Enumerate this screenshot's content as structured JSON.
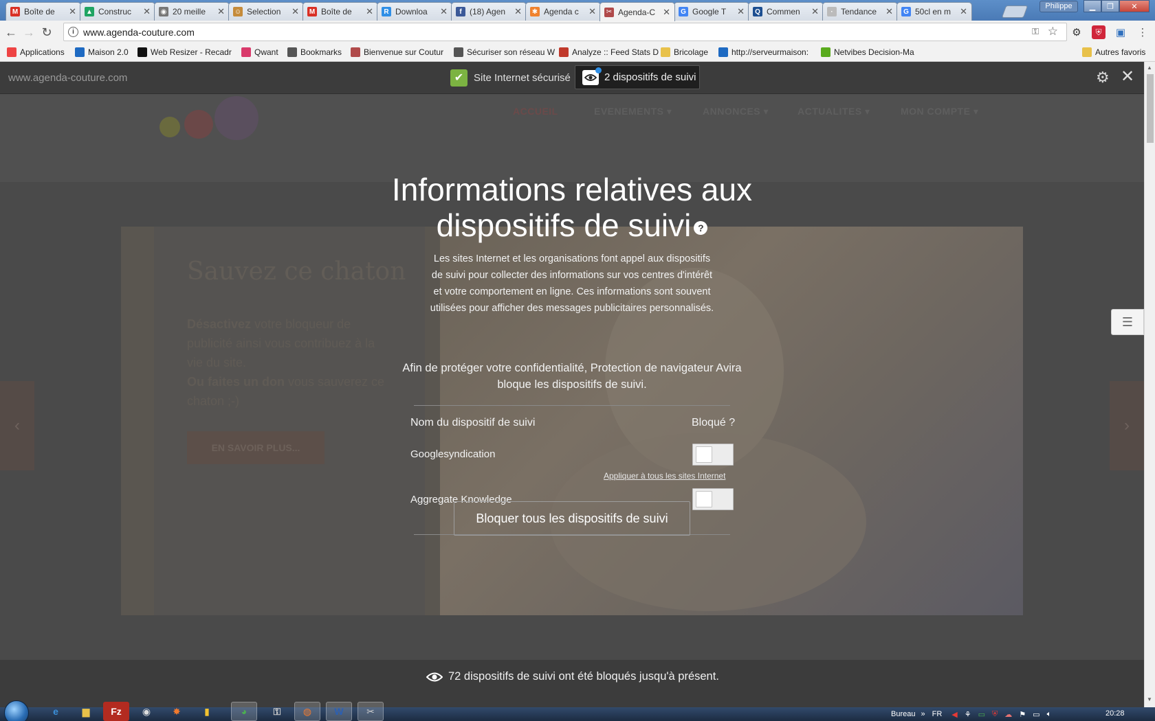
{
  "browser": {
    "tabs": [
      {
        "label": "Boîte de",
        "icon": "gmail-icon",
        "color": "#d93025",
        "glyph": "M"
      },
      {
        "label": "Construc",
        "icon": "drive-icon",
        "color": "#1fa463",
        "glyph": "▲"
      },
      {
        "label": "20 meille",
        "icon": "site-icon",
        "color": "#777777",
        "glyph": "◉"
      },
      {
        "label": "Selection",
        "icon": "site-icon",
        "color": "#c58b3a",
        "glyph": "☺"
      },
      {
        "label": "Boîte de",
        "icon": "gmail-icon",
        "color": "#d93025",
        "glyph": "M"
      },
      {
        "label": "Downloa",
        "icon": "site-icon",
        "color": "#2f8fe6",
        "glyph": "R"
      },
      {
        "label": "(18) Agen",
        "icon": "facebook-icon",
        "color": "#3b5998",
        "glyph": "f"
      },
      {
        "label": "Agenda c",
        "icon": "joomla-icon",
        "color": "#f0822e",
        "glyph": "✱"
      },
      {
        "label": "Agenda-C",
        "icon": "scissors-icon",
        "color": "#b04a4a",
        "glyph": "✂",
        "active": true
      },
      {
        "label": "Google T",
        "icon": "google-icon",
        "color": "#4285f4",
        "glyph": "G"
      },
      {
        "label": "Commen",
        "icon": "qwant-icon",
        "color": "#1d4f91",
        "glyph": "Q"
      },
      {
        "label": "Tendance",
        "icon": "site-icon",
        "color": "#bbbbbb",
        "glyph": "·"
      },
      {
        "label": "50cl en m",
        "icon": "google-icon",
        "color": "#4285f4",
        "glyph": "G"
      }
    ],
    "profile_name": "Philippe",
    "url": "www.agenda-couture.com",
    "bookmarks": [
      {
        "label": "Applications",
        "icon": "apps-grid-icon",
        "color": "#e44"
      },
      {
        "label": "Maison 2.0",
        "icon": "dsm-icon",
        "color": "#1e6ac2"
      },
      {
        "label": "Web Resizer - Recadr",
        "icon": "resizer-icon",
        "color": "#111"
      },
      {
        "label": "Qwant",
        "icon": "qwant-icon",
        "color": "#d93a6b"
      },
      {
        "label": "Bookmarks",
        "icon": "star-icon",
        "color": "#555"
      },
      {
        "label": "Bienvenue sur Coutur",
        "icon": "scissors-icon",
        "color": "#b04a4a"
      },
      {
        "label": "Sécuriser son réseau W",
        "icon": "site-icon",
        "color": "#555"
      },
      {
        "label": "Analyze :: Feed Stats D",
        "icon": "feed-icon",
        "color": "#c0392b"
      },
      {
        "label": "Bricolage",
        "icon": "folder-icon",
        "color": "#e8c14a"
      },
      {
        "label": "http://serveurmaison:",
        "icon": "dsm-icon",
        "color": "#1e6ac2"
      },
      {
        "label": "Netvibes Decision-Ma",
        "icon": "netvibes-icon",
        "color": "#5aab1e"
      },
      {
        "label": "Autres favoris",
        "icon": "folder-icon",
        "color": "#e8c14a"
      }
    ]
  },
  "website": {
    "menu": [
      "ACCUEIL",
      "EVENEMENTS ▾",
      "ANNONCES ▾",
      "ACTUALITES ▾",
      "MON COMPTE ▾"
    ],
    "hero_title": "Sauvez ce chaton",
    "hero_text_bold1": "Désactivez",
    "hero_text1": " votre bloqueur de publicité ainsi vous contribuez à la vie du site.",
    "hero_text_bold2": "Ou faites un don",
    "hero_text2": " vous sauverez ce chaton ;-)",
    "hero_button": "EN SAVOIR PLUS..."
  },
  "avira": {
    "domain": "www.agenda-couture.com",
    "secure_label": "Site Internet sécurisé",
    "tracker_badge": "2 dispositifs de suivi",
    "title": "Informations relatives aux dispositifs de suivi",
    "help_glyph": "?",
    "description": "Les sites Internet et les organisations font appel aux dispositifs de suivi pour collecter des informations sur vos centres d'intérêt et votre comportement en ligne. Ces informations sont souvent utilisées pour afficher des messages publicitaires personnalisés.",
    "protection_text": "Afin de protéger votre confidentialité, Protection de navigateur Avira bloque les dispositifs de suivi.",
    "column_name": "Nom du dispositif de suivi",
    "column_blocked": "Bloqué ?",
    "trackers": [
      {
        "name": "Googlesyndication",
        "blocked": false
      },
      {
        "name": "Aggregate Knowledge",
        "blocked": false
      }
    ],
    "apply_all": "Appliquer à tous les sites Internet",
    "block_all_button": "Bloquer tous les dispositifs de suivi",
    "footer_text": "72 dispositifs de suivi ont été bloqués jusqu'à présent."
  },
  "taskbar": {
    "desktop_label": "Bureau",
    "language": "FR",
    "clock": "20:28"
  }
}
